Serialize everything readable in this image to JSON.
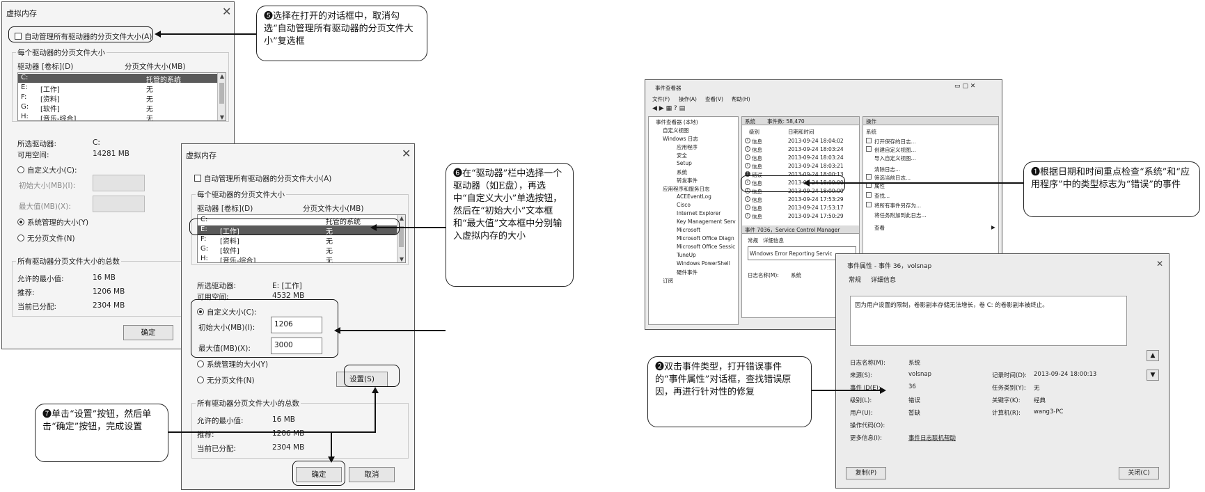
{
  "dialog1": {
    "title": "虚拟内存",
    "auto_manage": "自动管理所有驱动器的分页文件大小(A)",
    "group_title": "每个驱动器的分页文件大小",
    "col_drive": "驱动器 [卷标](D)",
    "col_size": "分页文件大小(MB)",
    "rows": [
      {
        "drive": "C:",
        "label": "",
        "size": "托管的系统"
      },
      {
        "drive": "E:",
        "label": "[工作]",
        "size": "无"
      },
      {
        "drive": "F:",
        "label": "[资料]",
        "size": "无"
      },
      {
        "drive": "G:",
        "label": "[软件]",
        "size": "无"
      },
      {
        "drive": "H:",
        "label": "[音乐-综合]",
        "size": "无"
      }
    ],
    "selected_drive_label": "所选驱动器:",
    "selected_drive": "C:",
    "free_space_label": "可用空间:",
    "free_space": "14281 MB",
    "custom_size": "自定义大小(C):",
    "initial_size": "初始大小(MB)(I):",
    "max_size": "最大值(MB)(X):",
    "system_managed": "系统管理的大小(Y)",
    "no_paging": "无分页文件(N)",
    "total_group": "所有驱动器分页文件大小的总数",
    "min_allowed_label": "允许的最小值:",
    "min_allowed": "16 MB",
    "recommended_label": "推荐:",
    "recommended": "1206 MB",
    "current_label": "当前已分配:",
    "current": "2304 MB",
    "ok": "确定"
  },
  "dialog2": {
    "title": "虚拟内存",
    "auto_manage": "自动管理所有驱动器的分页文件大小(A)",
    "group_title": "每个驱动器的分页文件大小",
    "col_drive": "驱动器 [卷标](D)",
    "col_size": "分页文件大小(MB)",
    "rows": [
      {
        "drive": "C:",
        "label": "",
        "size": "托管的系统"
      },
      {
        "drive": "E:",
        "label": "[工作]",
        "size": "无"
      },
      {
        "drive": "F:",
        "label": "[资料]",
        "size": "无"
      },
      {
        "drive": "G:",
        "label": "[软件]",
        "size": "无"
      },
      {
        "drive": "H:",
        "label": "[音乐-综合]",
        "size": "无"
      }
    ],
    "selected_drive_label": "所选驱动器:",
    "selected_drive": "E: [工作]",
    "free_space_label": "可用空间:",
    "free_space": "4532 MB",
    "custom_size": "自定义大小(C):",
    "initial_size": "初始大小(MB)(I):",
    "initial_value": "1206",
    "max_size": "最大值(MB)(X):",
    "max_value": "3000",
    "system_managed": "系统管理的大小(Y)",
    "no_paging": "无分页文件(N)",
    "set": "设置(S)",
    "total_group": "所有驱动器分页文件大小的总数",
    "min_allowed_label": "允许的最小值:",
    "min_allowed": "16 MB",
    "recommended_label": "推荐:",
    "recommended": "1206 MB",
    "current_label": "当前已分配:",
    "current": "2304 MB",
    "ok": "确定",
    "cancel": "取消"
  },
  "callouts": {
    "c5": "❺选择在打开的对话框中，取消勾选“自动管理所有驱动器的分页文件大小”复选框",
    "c6": "❻在“驱动器”栏中选择一个驱动器（如E盘），再选中“自定义大小”单选按钮，然后在“初始大小”文本框和“最大值”文本框中分别输入虚拟内存的大小",
    "c7": "❼单击“设置”按钮，然后单击“确定”按钮，完成设置",
    "c1": "❶根据日期和时间重点检查“系统”和“应用程序”中的类型标志为“错误”的事件",
    "c2": "❷双击事件类型，打开错误事件的“事件属性”对话框，查找错误原因，再进行针对性的修复"
  },
  "event_viewer": {
    "title": "事件查看器",
    "menu": [
      "文件(F)",
      "操作(A)",
      "查看(V)",
      "帮助(H)"
    ],
    "tree": [
      "事件查看器 (本地)",
      "自定义视图",
      "Windows 日志",
      "应用程序",
      "安全",
      "Setup",
      "系统",
      "转发事件",
      "应用程序和服务日志",
      "ACEEventLog",
      "Cisco",
      "Internet Explorer",
      "Key Management Serv",
      "Microsoft",
      "Microsoft Office Diagn",
      "Microsoft Office Sessic",
      "TuneUp",
      "Windows PowerShell",
      "硬件事件",
      "订阅"
    ],
    "list_title": "系统",
    "list_count": "事件数: 58,470",
    "col_level": "级别",
    "col_date": "日期和时间",
    "events": [
      {
        "level": "信息",
        "time": "2013-09-24 18:04:02"
      },
      {
        "level": "信息",
        "time": "2013-09-24 18:03:24"
      },
      {
        "level": "信息",
        "time": "2013-09-24 18:03:24"
      },
      {
        "level": "信息",
        "time": "2013-09-24 18:03:21"
      },
      {
        "level": "错误",
        "time": "2013-09-24 18:00:13"
      },
      {
        "level": "信息",
        "time": "2013-09-24 18:00:00"
      },
      {
        "level": "信息",
        "time": "2013-09-24 18:00:00"
      },
      {
        "level": "信息",
        "time": "2013-09-24 17:53:29"
      },
      {
        "level": "信息",
        "time": "2013-09-24 17:53:17"
      },
      {
        "level": "信息",
        "time": "2013-09-24 17:50:29"
      }
    ],
    "detail_title": "事件 7036，Service Control Manager",
    "detail_tabs": [
      "常规",
      "详细信息"
    ],
    "detail_text": "Windows Error Reporting Servic",
    "detail_log_label": "日志名称(M):",
    "detail_log": "系统",
    "actions_title": "操作",
    "actions_section": "系统",
    "actions": [
      "打开保存的日志...",
      "创建自定义视图...",
      "导入自定义视图...",
      "清除日志...",
      "筛选当前日志...",
      "属性",
      "查找...",
      "将所有事件另存为...",
      "将任务附加到此日志...",
      "查看"
    ]
  },
  "event_props": {
    "title": "事件属性 - 事件 36，volsnap",
    "tabs": [
      "常规",
      "详细信息"
    ],
    "message": "因为用户设置的限制，卷影副本存储无法增长，卷 C: 的卷影副本被终止。",
    "fields": [
      {
        "label": "日志名称(M):",
        "value": "系统"
      },
      {
        "label": "来源(S):",
        "value": "volsnap"
      },
      {
        "label": "事件 ID(E):",
        "value": "36"
      },
      {
        "label": "级别(L):",
        "value": "错误"
      },
      {
        "label": "用户(U):",
        "value": "暂缺"
      },
      {
        "label": "操作代码(O):",
        "value": ""
      },
      {
        "label": "更多信息(I):",
        "value": "事件日志联机帮助"
      }
    ],
    "fields_right": [
      {
        "label": "记录时间(D):",
        "value": "2013-09-24 18:00:13"
      },
      {
        "label": "任务类别(Y):",
        "value": "无"
      },
      {
        "label": "关键字(K):",
        "value": "经典"
      },
      {
        "label": "计算机(R):",
        "value": "wang3-PC"
      }
    ],
    "copy": "复制(P)",
    "close": "关闭(C)"
  }
}
